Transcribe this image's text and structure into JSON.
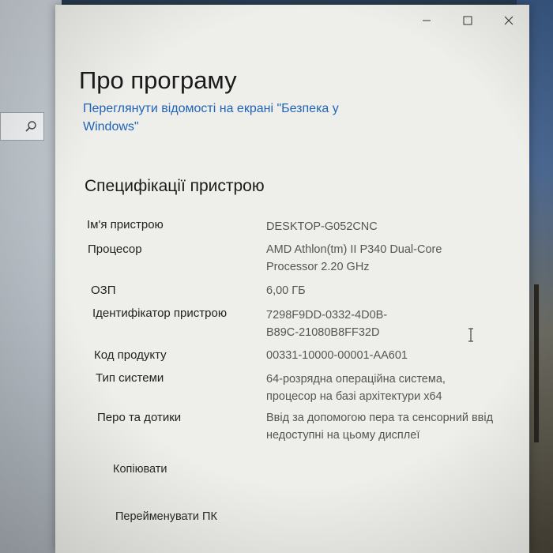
{
  "window": {
    "title": "Про програму",
    "security_link": "Переглянути відомості на екрані \"Безпека у Windows\""
  },
  "specs": {
    "heading": "Специфікації пристрою",
    "rows": [
      {
        "label": "Ім'я пристрою",
        "value": "DESKTOP-G052CNC"
      },
      {
        "label": "Процесор",
        "value": "AMD Athlon(tm) II P340 Dual-Core Processor   2.20 GHz"
      },
      {
        "label": "ОЗП",
        "value": "6,00 ГБ"
      },
      {
        "label": "Ідентифікатор пристрою",
        "value": "7298F9DD-0332-4D0B-B89C-21080B8FF32D"
      },
      {
        "label": "Код продукту",
        "value": "00331-10000-00001-AA601"
      },
      {
        "label": "Тип системи",
        "value": "64-розрядна операційна система, процесор на базі архітектури x64"
      },
      {
        "label": "Перо та дотики",
        "value": "Ввід за допомогою пера та сенсорний ввід недоступні на цьому дисплеї"
      }
    ]
  },
  "actions": {
    "copy_label": "Копіювати",
    "rename_label": "Перейменувати ПК"
  },
  "icons": {
    "search": "search-icon",
    "minimize": "minimize-icon",
    "maximize": "maximize-icon",
    "close": "close-icon",
    "cursor": "text-cursor-icon"
  }
}
